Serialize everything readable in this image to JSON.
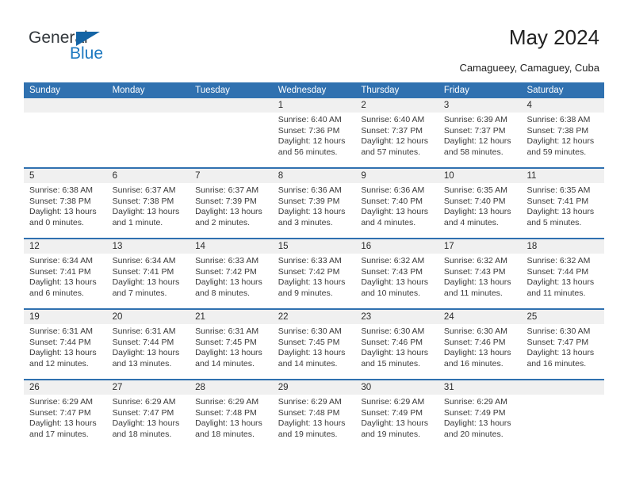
{
  "brand": {
    "word_one": "General",
    "word_two": "Blue",
    "triangle_icon": "triangle-icon",
    "accent_color": "#1c78c0",
    "triangle_color": "#1464a5"
  },
  "header": {
    "title": "May 2024",
    "subtitle": "Camagueey, Camaguey, Cuba"
  },
  "calendar": {
    "header_bg": "#3071b0",
    "daynum_bg": "#f0f0f0",
    "weekdays": [
      "Sunday",
      "Monday",
      "Tuesday",
      "Wednesday",
      "Thursday",
      "Friday",
      "Saturday"
    ],
    "weeks": [
      [
        {
          "day": "",
          "sunrise": "",
          "sunset": "",
          "daylight": ""
        },
        {
          "day": "",
          "sunrise": "",
          "sunset": "",
          "daylight": ""
        },
        {
          "day": "",
          "sunrise": "",
          "sunset": "",
          "daylight": ""
        },
        {
          "day": "1",
          "sunrise": "Sunrise: 6:40 AM",
          "sunset": "Sunset: 7:36 PM",
          "daylight": "Daylight: 12 hours and 56 minutes."
        },
        {
          "day": "2",
          "sunrise": "Sunrise: 6:40 AM",
          "sunset": "Sunset: 7:37 PM",
          "daylight": "Daylight: 12 hours and 57 minutes."
        },
        {
          "day": "3",
          "sunrise": "Sunrise: 6:39 AM",
          "sunset": "Sunset: 7:37 PM",
          "daylight": "Daylight: 12 hours and 58 minutes."
        },
        {
          "day": "4",
          "sunrise": "Sunrise: 6:38 AM",
          "sunset": "Sunset: 7:38 PM",
          "daylight": "Daylight: 12 hours and 59 minutes."
        }
      ],
      [
        {
          "day": "5",
          "sunrise": "Sunrise: 6:38 AM",
          "sunset": "Sunset: 7:38 PM",
          "daylight": "Daylight: 13 hours and 0 minutes."
        },
        {
          "day": "6",
          "sunrise": "Sunrise: 6:37 AM",
          "sunset": "Sunset: 7:38 PM",
          "daylight": "Daylight: 13 hours and 1 minute."
        },
        {
          "day": "7",
          "sunrise": "Sunrise: 6:37 AM",
          "sunset": "Sunset: 7:39 PM",
          "daylight": "Daylight: 13 hours and 2 minutes."
        },
        {
          "day": "8",
          "sunrise": "Sunrise: 6:36 AM",
          "sunset": "Sunset: 7:39 PM",
          "daylight": "Daylight: 13 hours and 3 minutes."
        },
        {
          "day": "9",
          "sunrise": "Sunrise: 6:36 AM",
          "sunset": "Sunset: 7:40 PM",
          "daylight": "Daylight: 13 hours and 4 minutes."
        },
        {
          "day": "10",
          "sunrise": "Sunrise: 6:35 AM",
          "sunset": "Sunset: 7:40 PM",
          "daylight": "Daylight: 13 hours and 4 minutes."
        },
        {
          "day": "11",
          "sunrise": "Sunrise: 6:35 AM",
          "sunset": "Sunset: 7:41 PM",
          "daylight": "Daylight: 13 hours and 5 minutes."
        }
      ],
      [
        {
          "day": "12",
          "sunrise": "Sunrise: 6:34 AM",
          "sunset": "Sunset: 7:41 PM",
          "daylight": "Daylight: 13 hours and 6 minutes."
        },
        {
          "day": "13",
          "sunrise": "Sunrise: 6:34 AM",
          "sunset": "Sunset: 7:41 PM",
          "daylight": "Daylight: 13 hours and 7 minutes."
        },
        {
          "day": "14",
          "sunrise": "Sunrise: 6:33 AM",
          "sunset": "Sunset: 7:42 PM",
          "daylight": "Daylight: 13 hours and 8 minutes."
        },
        {
          "day": "15",
          "sunrise": "Sunrise: 6:33 AM",
          "sunset": "Sunset: 7:42 PM",
          "daylight": "Daylight: 13 hours and 9 minutes."
        },
        {
          "day": "16",
          "sunrise": "Sunrise: 6:32 AM",
          "sunset": "Sunset: 7:43 PM",
          "daylight": "Daylight: 13 hours and 10 minutes."
        },
        {
          "day": "17",
          "sunrise": "Sunrise: 6:32 AM",
          "sunset": "Sunset: 7:43 PM",
          "daylight": "Daylight: 13 hours and 11 minutes."
        },
        {
          "day": "18",
          "sunrise": "Sunrise: 6:32 AM",
          "sunset": "Sunset: 7:44 PM",
          "daylight": "Daylight: 13 hours and 11 minutes."
        }
      ],
      [
        {
          "day": "19",
          "sunrise": "Sunrise: 6:31 AM",
          "sunset": "Sunset: 7:44 PM",
          "daylight": "Daylight: 13 hours and 12 minutes."
        },
        {
          "day": "20",
          "sunrise": "Sunrise: 6:31 AM",
          "sunset": "Sunset: 7:44 PM",
          "daylight": "Daylight: 13 hours and 13 minutes."
        },
        {
          "day": "21",
          "sunrise": "Sunrise: 6:31 AM",
          "sunset": "Sunset: 7:45 PM",
          "daylight": "Daylight: 13 hours and 14 minutes."
        },
        {
          "day": "22",
          "sunrise": "Sunrise: 6:30 AM",
          "sunset": "Sunset: 7:45 PM",
          "daylight": "Daylight: 13 hours and 14 minutes."
        },
        {
          "day": "23",
          "sunrise": "Sunrise: 6:30 AM",
          "sunset": "Sunset: 7:46 PM",
          "daylight": "Daylight: 13 hours and 15 minutes."
        },
        {
          "day": "24",
          "sunrise": "Sunrise: 6:30 AM",
          "sunset": "Sunset: 7:46 PM",
          "daylight": "Daylight: 13 hours and 16 minutes."
        },
        {
          "day": "25",
          "sunrise": "Sunrise: 6:30 AM",
          "sunset": "Sunset: 7:47 PM",
          "daylight": "Daylight: 13 hours and 16 minutes."
        }
      ],
      [
        {
          "day": "26",
          "sunrise": "Sunrise: 6:29 AM",
          "sunset": "Sunset: 7:47 PM",
          "daylight": "Daylight: 13 hours and 17 minutes."
        },
        {
          "day": "27",
          "sunrise": "Sunrise: 6:29 AM",
          "sunset": "Sunset: 7:47 PM",
          "daylight": "Daylight: 13 hours and 18 minutes."
        },
        {
          "day": "28",
          "sunrise": "Sunrise: 6:29 AM",
          "sunset": "Sunset: 7:48 PM",
          "daylight": "Daylight: 13 hours and 18 minutes."
        },
        {
          "day": "29",
          "sunrise": "Sunrise: 6:29 AM",
          "sunset": "Sunset: 7:48 PM",
          "daylight": "Daylight: 13 hours and 19 minutes."
        },
        {
          "day": "30",
          "sunrise": "Sunrise: 6:29 AM",
          "sunset": "Sunset: 7:49 PM",
          "daylight": "Daylight: 13 hours and 19 minutes."
        },
        {
          "day": "31",
          "sunrise": "Sunrise: 6:29 AM",
          "sunset": "Sunset: 7:49 PM",
          "daylight": "Daylight: 13 hours and 20 minutes."
        },
        {
          "day": "",
          "sunrise": "",
          "sunset": "",
          "daylight": ""
        }
      ]
    ]
  }
}
